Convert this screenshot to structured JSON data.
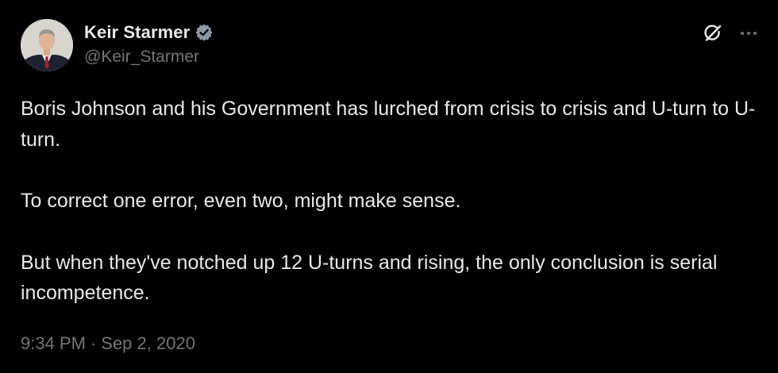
{
  "author": {
    "display_name": "Keir Starmer",
    "handle": "@Keir_Starmer",
    "verified": true,
    "verified_color": "#8b98a5"
  },
  "actions": {
    "grok_icon": "grok-icon",
    "more_icon": "more-icon"
  },
  "tweet": {
    "paragraphs": [
      "Boris Johnson and his Government has lurched from crisis to crisis and U-turn to U-turn.",
      "To correct one error, even two, might make sense.",
      "But when they've notched up 12 U-turns and rising, the only conclusion is serial incompetence."
    ]
  },
  "meta": {
    "time": "9:34 PM",
    "separator": "·",
    "date": "Sep 2, 2020"
  },
  "colors": {
    "background": "#000000",
    "text": "#e7e9ea",
    "muted": "#71767b"
  }
}
